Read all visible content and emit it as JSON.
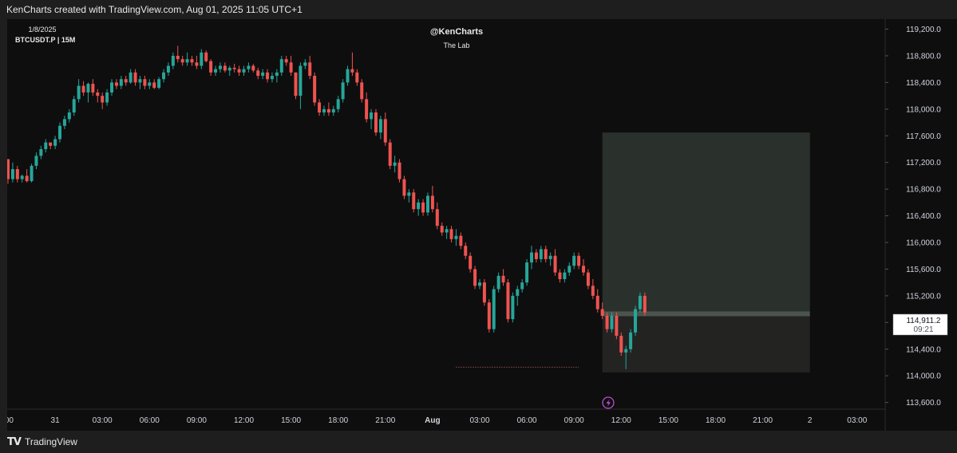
{
  "header": {
    "attribution": "KenCharts created with TradingView.com, Aug 01, 2025 11:05 UTC+1"
  },
  "legend": {
    "date": "1/8/2025",
    "symbol": "BTCUSDT.P | 15M"
  },
  "watermark": {
    "author": "@KenCharts",
    "subtitle": "The Lab"
  },
  "footer": {
    "brand": "TradingView",
    "logo_icon": "tradingview-logo-icon"
  },
  "colors": {
    "up": "#26a69a",
    "down": "#ef5350",
    "background": "#0e0e0e",
    "box": "#2a302b",
    "box_lower": "#232322",
    "price_line": "#4b554d"
  },
  "chart_data": {
    "type": "candlestick",
    "symbol": "BTCUSDT.P",
    "timeframe": "15M",
    "y_ticks": [
      "119,200.0",
      "118,800.0",
      "118,400.0",
      "118,000.0",
      "117,600.0",
      "117,200.0",
      "116,800.0",
      "116,400.0",
      "116,000.0",
      "115,600.0",
      "115,200.0",
      "114,800.0",
      "114,400.0",
      "114,000.0",
      "113,600.0"
    ],
    "x_ticks": [
      ":00",
      "31",
      "03:00",
      "06:00",
      "09:00",
      "12:00",
      "15:00",
      "18:00",
      "21:00",
      "Aug",
      "03:00",
      "06:00",
      "09:00",
      "12:00",
      "15:00",
      "18:00",
      "21:00",
      "2",
      "03:00"
    ],
    "x_tick_index": [
      0,
      10,
      20,
      30,
      40,
      50,
      60,
      70,
      80,
      90,
      100,
      110,
      120,
      130,
      140,
      150,
      160,
      170,
      180
    ],
    "ylim": [
      113500,
      119350
    ],
    "last_price": {
      "price": "114,911.2",
      "countdown": "09:21"
    },
    "position_box": {
      "top": 117650,
      "entry": 114930,
      "bottom": 114050,
      "start_index": 126,
      "end_index": 170
    },
    "swing_low_line": {
      "price": 114130,
      "start_index": 95,
      "end_index": 121
    },
    "candles": [
      [
        117250,
        117250,
        116880,
        116950
      ],
      [
        116950,
        117200,
        116900,
        117100
      ],
      [
        117100,
        117150,
        116900,
        116950
      ],
      [
        116950,
        117020,
        116900,
        117000
      ],
      [
        117000,
        117100,
        116900,
        116920
      ],
      [
        116920,
        117180,
        116900,
        117150
      ],
      [
        117150,
        117350,
        117100,
        117300
      ],
      [
        117300,
        117450,
        117250,
        117400
      ],
      [
        117400,
        117550,
        117350,
        117500
      ],
      [
        117500,
        117500,
        117400,
        117450
      ],
      [
        117450,
        117600,
        117400,
        117550
      ],
      [
        117550,
        117800,
        117500,
        117750
      ],
      [
        117750,
        117900,
        117700,
        117850
      ],
      [
        117850,
        118000,
        117800,
        117950
      ],
      [
        117950,
        118200,
        117900,
        118150
      ],
      [
        118150,
        118450,
        118100,
        118350
      ],
      [
        118350,
        118420,
        118200,
        118250
      ],
      [
        118250,
        118400,
        118100,
        118380
      ],
      [
        118380,
        118450,
        118200,
        118250
      ],
      [
        118250,
        118300,
        118100,
        118200
      ],
      [
        118200,
        118250,
        118000,
        118100
      ],
      [
        118100,
        118300,
        118050,
        118250
      ],
      [
        118250,
        118450,
        118200,
        118400
      ],
      [
        118400,
        118450,
        118300,
        118350
      ],
      [
        118350,
        118500,
        118300,
        118450
      ],
      [
        118450,
        118500,
        118350,
        118400
      ],
      [
        118400,
        118600,
        118380,
        118550
      ],
      [
        118550,
        118600,
        118350,
        118400
      ],
      [
        118400,
        118500,
        118300,
        118450
      ],
      [
        118450,
        118500,
        118300,
        118350
      ],
      [
        118350,
        118450,
        118300,
        118400
      ],
      [
        118400,
        118450,
        118300,
        118320
      ],
      [
        118320,
        118480,
        118300,
        118450
      ],
      [
        118450,
        118600,
        118400,
        118550
      ],
      [
        118550,
        118700,
        118500,
        118650
      ],
      [
        118650,
        118850,
        118600,
        118800
      ],
      [
        118800,
        118950,
        118700,
        118750
      ],
      [
        118750,
        118800,
        118650,
        118700
      ],
      [
        118700,
        118850,
        118650,
        118750
      ],
      [
        118750,
        118800,
        118650,
        118700
      ],
      [
        118700,
        118800,
        118600,
        118650
      ],
      [
        118650,
        118900,
        118600,
        118850
      ],
      [
        118850,
        118880,
        118700,
        118720
      ],
      [
        118720,
        118750,
        118500,
        118550
      ],
      [
        118550,
        118650,
        118500,
        118600
      ],
      [
        118600,
        118700,
        118550,
        118650
      ],
      [
        118650,
        118700,
        118550,
        118580
      ],
      [
        118580,
        118650,
        118500,
        118620
      ],
      [
        118620,
        118680,
        118550,
        118600
      ],
      [
        118600,
        118650,
        118500,
        118550
      ],
      [
        118550,
        118650,
        118500,
        118600
      ],
      [
        118600,
        118700,
        118550,
        118650
      ],
      [
        118650,
        118680,
        118550,
        118580
      ],
      [
        118580,
        118620,
        118450,
        118500
      ],
      [
        118500,
        118600,
        118450,
        118550
      ],
      [
        118550,
        118600,
        118400,
        118450
      ],
      [
        118450,
        118550,
        118400,
        118500
      ],
      [
        118500,
        118600,
        118400,
        118550
      ],
      [
        118550,
        118800,
        118500,
        118750
      ],
      [
        118750,
        118800,
        118650,
        118700
      ],
      [
        118700,
        118800,
        118500,
        118550
      ],
      [
        118550,
        118550,
        118150,
        118200
      ],
      [
        118200,
        118700,
        118000,
        118650
      ],
      [
        118650,
        118750,
        118600,
        118700
      ],
      [
        118700,
        118800,
        118450,
        118500
      ],
      [
        118500,
        118550,
        118050,
        118100
      ],
      [
        118100,
        118150,
        117900,
        117950
      ],
      [
        117950,
        118050,
        117900,
        118000
      ],
      [
        118000,
        118100,
        117900,
        117950
      ],
      [
        117950,
        118050,
        117900,
        118000
      ],
      [
        118000,
        118200,
        117950,
        118150
      ],
      [
        118150,
        118450,
        118100,
        118400
      ],
      [
        118400,
        118650,
        118350,
        118600
      ],
      [
        118600,
        118850,
        118500,
        118550
      ],
      [
        118550,
        118600,
        118350,
        118400
      ],
      [
        118400,
        118450,
        118100,
        118150
      ],
      [
        118150,
        118250,
        117800,
        117850
      ],
      [
        117850,
        118000,
        117700,
        117950
      ],
      [
        117950,
        118000,
        117600,
        117650
      ],
      [
        117650,
        117900,
        117550,
        117850
      ],
      [
        117850,
        117950,
        117450,
        117500
      ],
      [
        117500,
        117550,
        117100,
        117150
      ],
      [
        117150,
        117300,
        117050,
        117200
      ],
      [
        117200,
        117250,
        116900,
        116950
      ],
      [
        116950,
        117000,
        116650,
        116700
      ],
      [
        116700,
        116800,
        116600,
        116750
      ],
      [
        116750,
        116800,
        116450,
        116500
      ],
      [
        116500,
        116650,
        116400,
        116600
      ],
      [
        116600,
        116650,
        116400,
        116450
      ],
      [
        116450,
        116750,
        116400,
        116700
      ],
      [
        116700,
        116850,
        116450,
        116500
      ],
      [
        116500,
        116600,
        116200,
        116250
      ],
      [
        116250,
        116300,
        116100,
        116150
      ],
      [
        116150,
        116250,
        116050,
        116200
      ],
      [
        116200,
        116250,
        116000,
        116050
      ],
      [
        116050,
        116200,
        115950,
        116100
      ],
      [
        116100,
        116150,
        115900,
        115950
      ],
      [
        115950,
        116000,
        115750,
        115800
      ],
      [
        115800,
        115850,
        115550,
        115600
      ],
      [
        115600,
        115650,
        115300,
        115350
      ],
      [
        115350,
        115450,
        115300,
        115400
      ],
      [
        115400,
        115450,
        115050,
        115100
      ],
      [
        115100,
        115150,
        114650,
        114700
      ],
      [
        114700,
        115350,
        114650,
        115300
      ],
      [
        115300,
        115550,
        115250,
        115500
      ],
      [
        115500,
        115600,
        115350,
        115400
      ],
      [
        115400,
        115450,
        114800,
        114850
      ],
      [
        114850,
        115250,
        114800,
        115200
      ],
      [
        115200,
        115350,
        115050,
        115300
      ],
      [
        115300,
        115450,
        115250,
        115400
      ],
      [
        115400,
        115750,
        115350,
        115700
      ],
      [
        115700,
        115950,
        115600,
        115850
      ],
      [
        115850,
        115900,
        115700,
        115750
      ],
      [
        115750,
        115950,
        115700,
        115900
      ],
      [
        115900,
        115950,
        115700,
        115750
      ],
      [
        115750,
        115850,
        115650,
        115800
      ],
      [
        115800,
        115900,
        115500,
        115550
      ],
      [
        115550,
        115600,
        115400,
        115450
      ],
      [
        115450,
        115600,
        115400,
        115550
      ],
      [
        115550,
        115700,
        115500,
        115650
      ],
      [
        115650,
        115850,
        115600,
        115800
      ],
      [
        115800,
        115850,
        115600,
        115650
      ],
      [
        115650,
        115750,
        115500,
        115550
      ],
      [
        115550,
        115600,
        115300,
        115350
      ],
      [
        115350,
        115450,
        115150,
        115200
      ],
      [
        115200,
        115300,
        114950,
        115000
      ],
      [
        115000,
        115100,
        114850,
        114900
      ],
      [
        114900,
        114950,
        114650,
        114700
      ],
      [
        114700,
        114950,
        114650,
        114900
      ],
      [
        114900,
        114950,
        114550,
        114600
      ],
      [
        114600,
        114650,
        114300,
        114350
      ],
      [
        114350,
        114450,
        114100,
        114400
      ],
      [
        114400,
        114700,
        114350,
        114650
      ],
      [
        114650,
        115050,
        114600,
        115000
      ],
      [
        115000,
        115250,
        114950,
        115200
      ],
      [
        115200,
        115250,
        114900,
        114950
      ]
    ]
  }
}
